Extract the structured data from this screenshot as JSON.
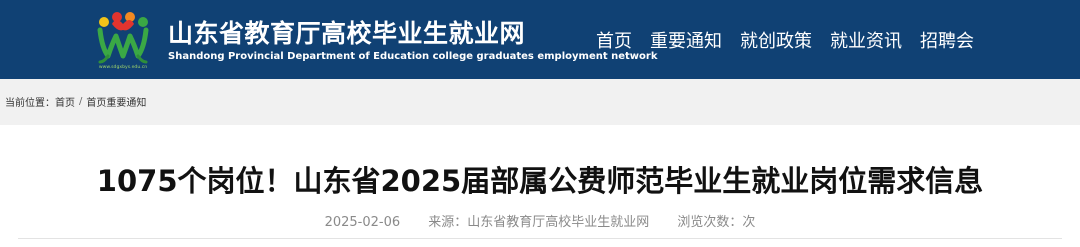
{
  "site": {
    "title": "山东省教育厅高校毕业生就业网",
    "subtitle": "Shandong Provincial Department of Education college graduates employment network",
    "logo_icon": "stick-figures-logo-icon",
    "logo_url_text": "www.sdgxbys.edu.cn",
    "header_color": "#104174"
  },
  "nav": {
    "items": [
      {
        "label": "首页"
      },
      {
        "label": "重要通知"
      },
      {
        "label": "就创政策"
      },
      {
        "label": "就业资讯"
      },
      {
        "label": "招聘会"
      }
    ]
  },
  "breadcrumb": {
    "prefix": "当前位置：",
    "items": [
      {
        "label": "首页"
      },
      {
        "label": "首页重要通知"
      }
    ],
    "separator": "/"
  },
  "article": {
    "title": "1075个岗位！山东省2025届部属公费师范毕业生就业岗位需求信息",
    "date": "2025-02-06",
    "source": "来源：山东省教育厅高校毕业生就业网",
    "views": "浏览次数：次"
  }
}
